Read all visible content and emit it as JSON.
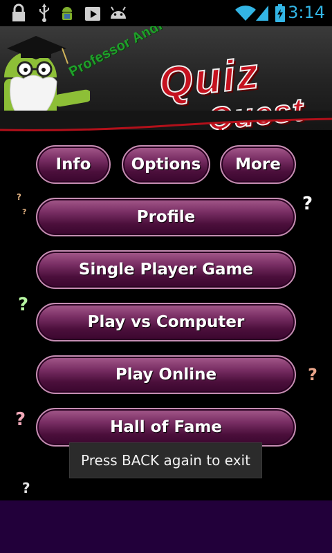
{
  "status_bar": {
    "time": "3:14",
    "time_color": "#33b5e5",
    "icons_left": [
      "lock-icon",
      "usb-icon",
      "android-bug-icon",
      "play-store-icon",
      "android-head-icon"
    ],
    "icons_right": [
      "wifi-icon",
      "signal-icon",
      "battery-icon"
    ]
  },
  "banner": {
    "professor_text": "Professor Android's",
    "quiz_text": "Quiz",
    "quest_text": "Quest"
  },
  "top_buttons": [
    {
      "label": "Info"
    },
    {
      "label": "Options"
    },
    {
      "label": "More"
    }
  ],
  "menu_buttons": [
    {
      "label": "Profile"
    },
    {
      "label": "Single Player Game"
    },
    {
      "label": "Play vs Computer"
    },
    {
      "label": "Play Online"
    },
    {
      "label": "Hall of Fame"
    }
  ],
  "decor": {
    "question_mark": "?"
  },
  "toast": {
    "message": "Press BACK again to exit"
  },
  "colors": {
    "button_purple": "#7a2f65",
    "banner_red": "#c5121f",
    "banner_green": "#1fa02a",
    "bottom_bar": "#22003a"
  }
}
